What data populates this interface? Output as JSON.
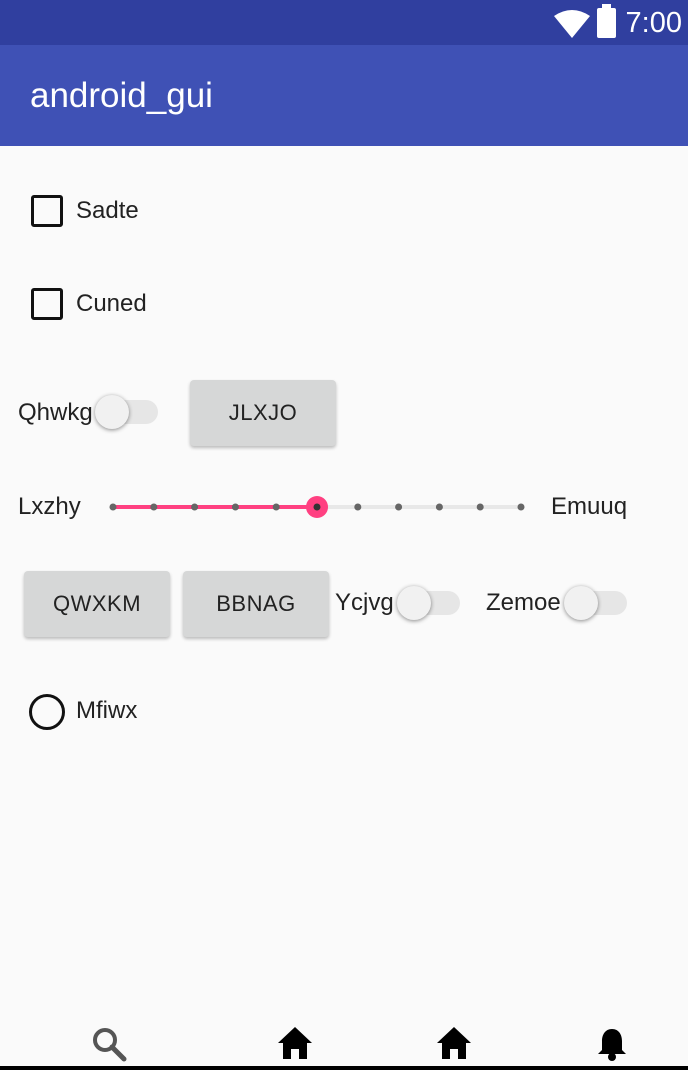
{
  "status_bar": {
    "time": "7:00",
    "icons": [
      "wifi-icon",
      "battery-icon"
    ]
  },
  "app_bar": {
    "title": "android_gui"
  },
  "checkboxes": [
    {
      "label": "Sadte",
      "checked": false
    },
    {
      "label": "Cuned",
      "checked": false
    }
  ],
  "row1": {
    "switch_label": "Qhwkg",
    "switch_on": false,
    "button_label": "JLXJO"
  },
  "slider": {
    "left_label": "Lxzhy",
    "right_label": "Emuuq",
    "min": 0,
    "max": 10,
    "value": 5,
    "ticks": 11,
    "accent_color": "#ff4081"
  },
  "row2": {
    "button1_label": "QWXKM",
    "button2_label": "BBNAG",
    "switch1_label": "Ycjvg",
    "switch1_on": false,
    "switch2_label": "Zemoe",
    "switch2_on": false
  },
  "radio": {
    "label": "Mfiwx",
    "checked": false
  },
  "bottom_nav": {
    "icons": [
      "search-icon",
      "home-icon",
      "home-icon",
      "bell-icon"
    ]
  },
  "colors": {
    "primary": "#3f51b5",
    "primary_dark": "#303f9f",
    "accent": "#ff4081"
  }
}
